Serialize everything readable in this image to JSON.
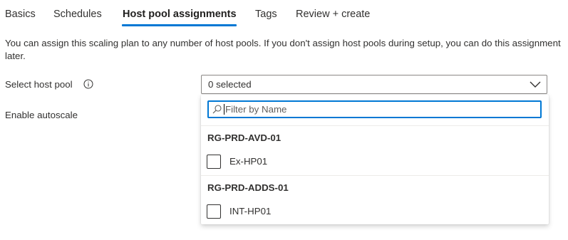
{
  "tabs": [
    {
      "label": "Basics",
      "active": false
    },
    {
      "label": "Schedules",
      "active": false
    },
    {
      "label": "Host pool assignments",
      "active": true
    },
    {
      "label": "Tags",
      "active": false
    },
    {
      "label": "Review + create",
      "active": false
    }
  ],
  "description": "You can assign this scaling plan to any number of host pools. If you don't assign host pools during setup, you can do this assignment later.",
  "fields": {
    "host_pool_label": "Select host pool",
    "autoscale_label": "Enable autoscale"
  },
  "dropdown": {
    "value": "0 selected",
    "filter_placeholder": "Filter by Name",
    "groups": [
      {
        "header": "RG-PRD-AVD-01",
        "options": [
          {
            "label": "Ex-HP01",
            "checked": false
          }
        ]
      },
      {
        "header": "RG-PRD-ADDS-01",
        "options": [
          {
            "label": "INT-HP01",
            "checked": false
          }
        ]
      }
    ]
  },
  "colors": {
    "accent": "#0078d4",
    "text": "#323130",
    "border": "#8a8886"
  },
  "icons": [
    "info-icon",
    "chevron-down-icon",
    "search-icon"
  ]
}
